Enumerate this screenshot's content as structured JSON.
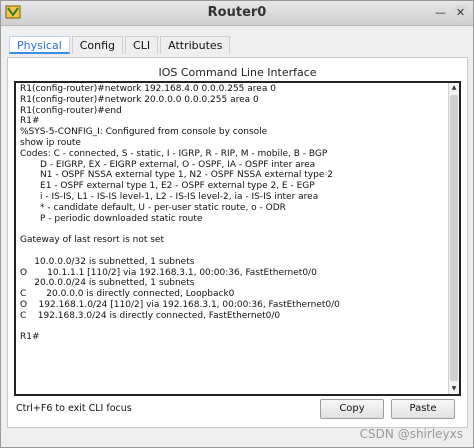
{
  "window": {
    "title": "Router0",
    "controls": {
      "minimize": "—",
      "close": "✕"
    }
  },
  "tabs": [
    {
      "label": "Physical",
      "active": true
    },
    {
      "label": "Config",
      "active": false
    },
    {
      "label": "CLI",
      "active": false
    },
    {
      "label": "Attributes",
      "active": false
    }
  ],
  "cli": {
    "heading": "IOS Command Line Interface",
    "lines": [
      "R1(config-router)#network 192.168.4.0 0.0.0.255 area 0",
      "R1(config-router)#network 20.0.0.0 0.0.0.255 area 0",
      "R1(config-router)#end",
      "R1#",
      "%SYS-5-CONFIG_I: Configured from console by console",
      "show ip route",
      "Codes: C - connected, S - static, I - IGRP, R - RIP, M - mobile, B - BGP",
      "       D - EIGRP, EX - EIGRP external, O - OSPF, IA - OSPF inter area",
      "       N1 - OSPF NSSA external type 1, N2 - OSPF NSSA external type 2",
      "       E1 - OSPF external type 1, E2 - OSPF external type 2, E - EGP",
      "       i - IS-IS, L1 - IS-IS level-1, L2 - IS-IS level-2, ia - IS-IS inter area",
      "       * - candidate default, U - per-user static route, o - ODR",
      "       P - periodic downloaded static route",
      "",
      "Gateway of last resort is not set",
      "",
      "     10.0.0.0/32 is subnetted, 1 subnets",
      "O       10.1.1.1 [110/2] via 192.168.3.1, 00:00:36, FastEthernet0/0",
      "     20.0.0.0/24 is subnetted, 1 subnets",
      "C       20.0.0.0 is directly connected, Loopback0",
      "O    192.168.1.0/24 [110/2] via 192.168.3.1, 00:00:36, FastEthernet0/0",
      "C    192.168.3.0/24 is directly connected, FastEthernet0/0",
      "",
      "R1#"
    ],
    "footer_hint": "Ctrl+F6 to exit CLI focus",
    "copy_label": "Copy",
    "paste_label": "Paste"
  },
  "watermark": "CSDN @shirleyxs",
  "colors": {
    "active_tab_text": "#2a6fd6",
    "console_border": "#222222"
  }
}
